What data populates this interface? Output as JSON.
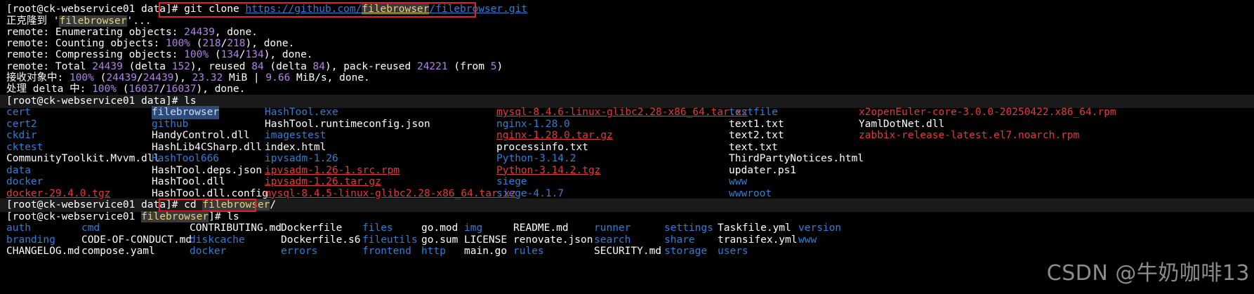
{
  "prompt": "[root@ck-webservice01 data]# ",
  "prompt_fb_pre": "[root@ck-webservice01 ",
  "prompt_fb_dir": "filebrowser",
  "prompt_fb_post": "]# ",
  "clone": {
    "cmd_a": "git clone ",
    "url_a": "https://github.com/",
    "url_b": "filebrowser",
    "url_c": "/",
    "url_d": "filebrowser",
    "url_e": ".git"
  },
  "output": {
    "cloning_a": "正克隆到 '",
    "cloning_b": "filebrowser",
    "cloning_c": "'...",
    "enum_a": "remote: Enumerating objects: ",
    "enum_n": "24439",
    "enum_b": ", done.",
    "count_a": "remote: Counting objects: ",
    "count_p": "100%",
    "count_b": " (",
    "count_n1": "218",
    "count_s": "/",
    "count_n2": "218",
    "count_c": "), done.",
    "comp_a": "remote: Compressing objects: ",
    "comp_p": "100%",
    "comp_b": " (",
    "comp_n1": "134",
    "comp_s": "/",
    "comp_n2": "134",
    "comp_c": "), done.",
    "total_a": "remote: Total ",
    "total_n": "24439",
    "total_b": " (delta ",
    "total_d": "152",
    "total_c": "), reused ",
    "total_r": "84",
    "total_e": " (delta ",
    "total_rd": "84",
    "total_f": "), pack-reused ",
    "total_pr": "24221",
    "total_g": " (from ",
    "total_fr": "5",
    "total_h": ")",
    "recv_a": "接收对象中: ",
    "recv_p": "100%",
    "recv_b": " (",
    "recv_n1": "24439",
    "recv_s": "/",
    "recv_n2": "24439",
    "recv_c": "), ",
    "recv_mb": "23.32",
    "recv_d": " MiB | ",
    "recv_sp": "9.66",
    "recv_e": " MiB/s, done.",
    "delta_a": "处理 delta 中: ",
    "delta_p": "100%",
    "delta_b": " (",
    "delta_n1": "16037",
    "delta_s": "/",
    "delta_n2": "16037",
    "delta_c": "), done."
  },
  "cmd_ls": "ls",
  "cmd_cd_a": "cd ",
  "cmd_cd_b": "filebrowser",
  "cmd_cd_c": "/",
  "ls1": [
    [
      "cert",
      "cert2",
      "ckdir",
      "cktest",
      "CommunityToolkit.Mvvm.dll",
      "data",
      "docker",
      "docker-29.4.0.tgz"
    ],
    [
      "filebrowser",
      "github",
      "HandyControl.dll",
      "HashLib4CSharp.dll",
      "HashTool666",
      "HashTool.deps.json",
      "HashTool.dll",
      "HashTool.dll.config"
    ],
    [
      "HashTool.exe",
      "HashTool.runtimeconfig.json",
      "imagestest",
      "index.html",
      "ipvsadm-1.26",
      "ipvsadm-1.26-1.src.rpm",
      "ipvsadm-1.26.tar.gz",
      "mysql-8.4.5-linux-glibc2.28-x86_64.tar.xz"
    ],
    [
      "mysql-8.4.6-linux-glibc2.28-x86_64.tar.xz",
      "nginx-1.28.0",
      "nginx-1.28.0.tar.gz",
      "processinfo.txt",
      "Python-3.14.2",
      "Python-3.14.2.tgz",
      "siege",
      "siege-4.1.7"
    ],
    [
      "testfile",
      "text1.txt",
      "text2.txt",
      "text.txt",
      "ThirdPartyNotices.html",
      "updater.ps1",
      "www",
      "wwwroot"
    ],
    [
      "x2openEuler-core-3.0.0-20250422.x86_64.rpm",
      "YamlDotNet.dll",
      "zabbix-release-latest.el7.noarch.rpm"
    ]
  ],
  "ls2": [
    [
      "auth",
      "branding",
      "CHANGELOG.md"
    ],
    [
      "cmd",
      "CODE-OF-CONDUCT.md",
      "compose.yaml"
    ],
    [
      "CONTRIBUTING.md",
      "diskcache",
      "docker"
    ],
    [
      "Dockerfile",
      "Dockerfile.s6",
      "errors"
    ],
    [
      "files",
      "fileutils",
      "frontend"
    ],
    [
      "go.mod",
      "go.sum",
      "http"
    ],
    [
      "img",
      "LICENSE",
      "main.go"
    ],
    [
      "README.md",
      "renovate.json",
      "rules"
    ],
    [
      "runner",
      "search",
      "SECURITY.md"
    ],
    [
      "settings",
      "share",
      "storage"
    ],
    [
      "Taskfile.yml",
      "transifex.yml",
      "users"
    ],
    [
      "version",
      "www",
      ""
    ]
  ],
  "watermark": "CSDN @牛奶咖啡13",
  "colors": {
    "dir": "#2f7fd6",
    "archive": "#e23a3a",
    "number": "#b084e6",
    "box": "#e0232b"
  }
}
